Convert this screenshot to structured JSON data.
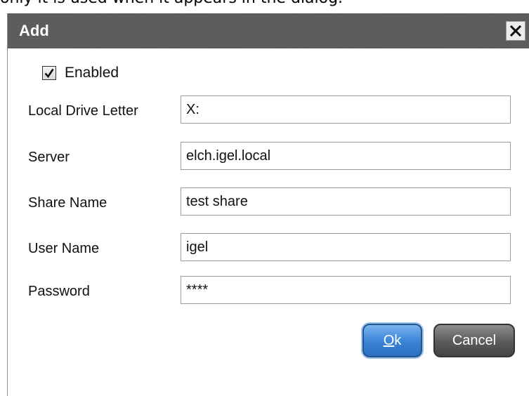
{
  "background_text": "only it is used when it appears in the dialog.",
  "dialog": {
    "title": "Add",
    "enabled": {
      "label": "Enabled",
      "checked": true
    },
    "fields": {
      "drive_letter": {
        "label": "Local Drive Letter",
        "value": "X:"
      },
      "server": {
        "label": "Server",
        "value": "elch.igel.local"
      },
      "share_name": {
        "label": "Share Name",
        "value": "test share"
      },
      "user_name": {
        "label": "User Name",
        "value": "igel"
      },
      "password": {
        "label": "Password",
        "value": "****"
      }
    },
    "buttons": {
      "ok_mnemonic": "O",
      "ok_rest": "k",
      "cancel": "Cancel"
    }
  },
  "icons": {
    "close": "close-icon",
    "check": "checkmark-icon"
  },
  "colors": {
    "titlebar": "#5c5c5c",
    "ok_button": "#3d86d8",
    "cancel_button": "#5a5a5a"
  }
}
